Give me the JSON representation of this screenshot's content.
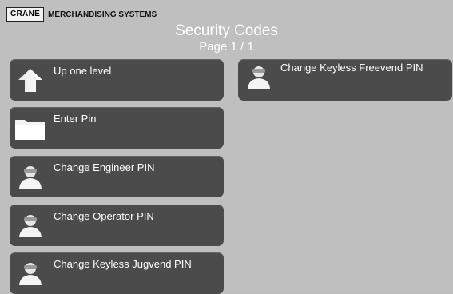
{
  "header": {
    "logo_box": "CRANE",
    "logo_text": "MERCHANDISING SYSTEMS",
    "title": "Security Codes",
    "page": "Page 1 / 1"
  },
  "menu": {
    "items": [
      {
        "label": "Up one level",
        "icon": "up-arrow-icon"
      },
      {
        "label": "Enter Pin",
        "icon": "folder-icon"
      },
      {
        "label": "Change Engineer PIN",
        "icon": "user-icon"
      },
      {
        "label": "Change Operator PIN",
        "icon": "user-icon"
      },
      {
        "label": "Change Keyless Jugvend PIN",
        "icon": "user-icon"
      },
      {
        "label": "Change Keyless Freevend PIN",
        "icon": "user-icon"
      }
    ]
  },
  "colors": {
    "background": "#bfbfbf",
    "tile": "#4b4b4b",
    "text": "#ffffff"
  }
}
